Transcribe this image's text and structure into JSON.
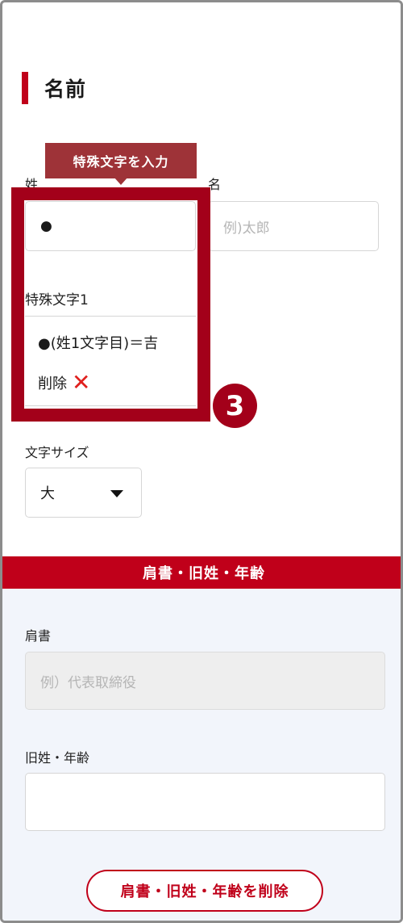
{
  "section_title": "名前",
  "tooltip": "特殊文字を入力",
  "last_name": {
    "label": "姓",
    "value": "●"
  },
  "first_name": {
    "label": "名",
    "placeholder": "例)太郎"
  },
  "special_chars": {
    "heading": "特殊文字1",
    "rule": "●(姓1文字目)＝吉",
    "delete_label": "削除",
    "delete_icon": "cross-mark"
  },
  "step_badge": "3",
  "font_size": {
    "label": "文字サイズ",
    "value": "大"
  },
  "title_section": {
    "band": "肩書・旧姓・年齢",
    "job_title": {
      "label": "肩書",
      "placeholder": "例）代表取締役"
    },
    "maiden_age": {
      "label": "旧姓・年齢",
      "value": ""
    },
    "delete_button": "肩書・旧姓・年齢を削除"
  },
  "colors": {
    "accent": "#c0001a",
    "tooltip": "#9e3338",
    "delete_icon": "#e0201e",
    "panel_bg": "#f2f5fb"
  }
}
